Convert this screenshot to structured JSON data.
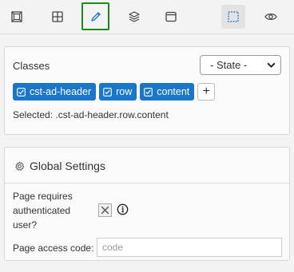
{
  "toolbar": {
    "buttons": [
      {
        "icon": "layout-icon"
      },
      {
        "icon": "grid-icon"
      },
      {
        "icon": "pencil-icon",
        "active": true
      },
      {
        "icon": "layers-icon"
      },
      {
        "icon": "window-icon"
      },
      {
        "icon": "selection-box-icon",
        "selected": true
      },
      {
        "icon": "eye-icon"
      }
    ],
    "active_border_color": "#1a8a1a"
  },
  "classes": {
    "title": "Classes",
    "state_select": "- State -",
    "tags": [
      "cst-ad-header",
      "row",
      "content"
    ],
    "add_label": "+",
    "selected_label": "Selected:",
    "selected_value": ".cst-ad-header.row.content",
    "tag_color": "#1976c8"
  },
  "global_settings": {
    "title": "Global Settings",
    "requires_auth_label": "Page requires authenticated user?",
    "access_code_label": "Page access code:",
    "access_code_placeholder": "code",
    "access_code_value": ""
  }
}
